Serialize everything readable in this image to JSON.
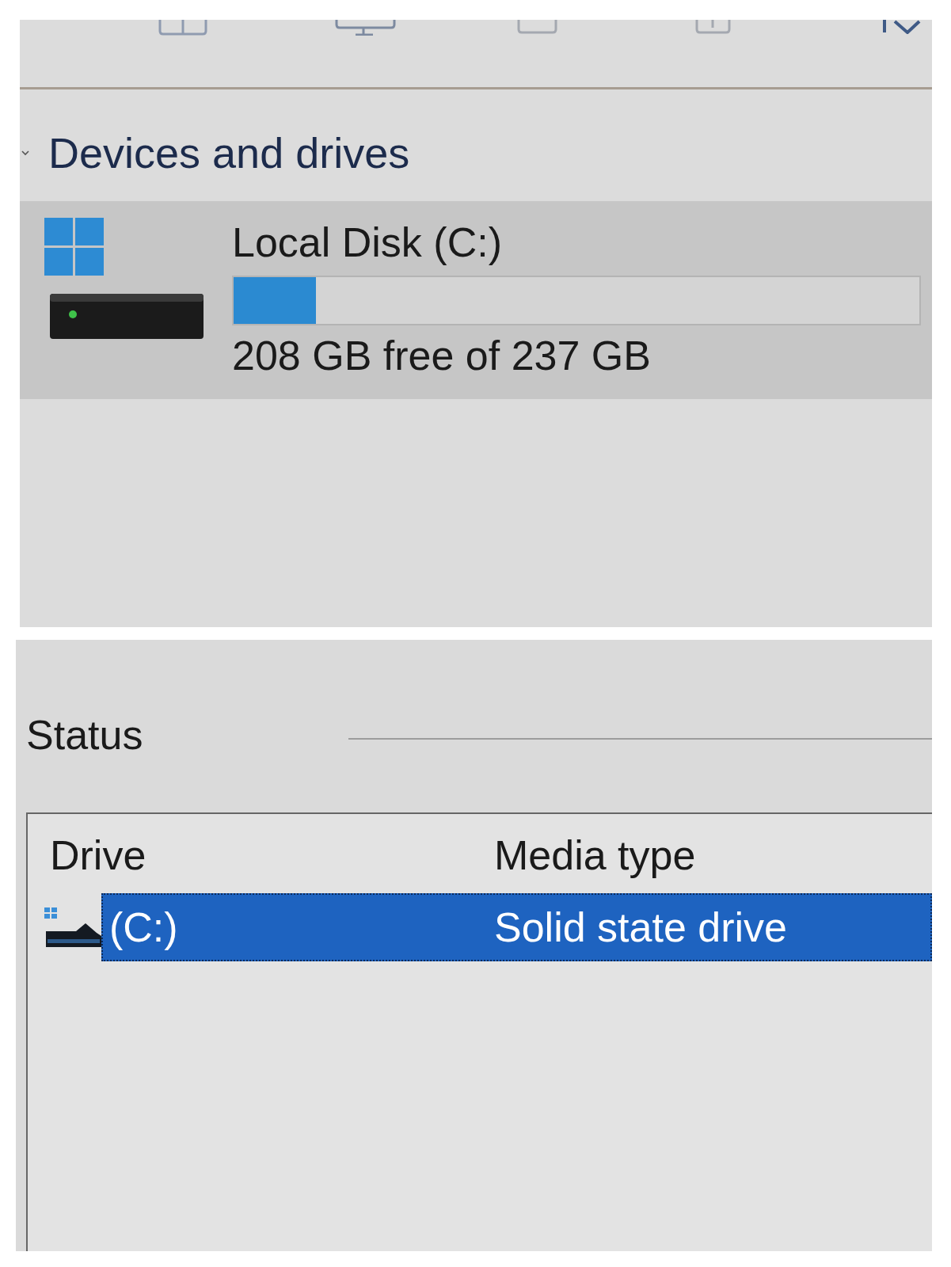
{
  "section": {
    "title": "Devices and drives",
    "expanded": true
  },
  "drives": [
    {
      "name": "Local Disk (C:)",
      "level": 0.12,
      "space": "208 GB free of 237 GB",
      "selected": true
    }
  ],
  "status": {
    "title": "Status",
    "columns": [
      "Drive",
      "Media type"
    ],
    "rows": [
      {
        "cells": [
          "(C:)",
          "Solid state drive"
        ],
        "selected": true
      }
    ]
  }
}
